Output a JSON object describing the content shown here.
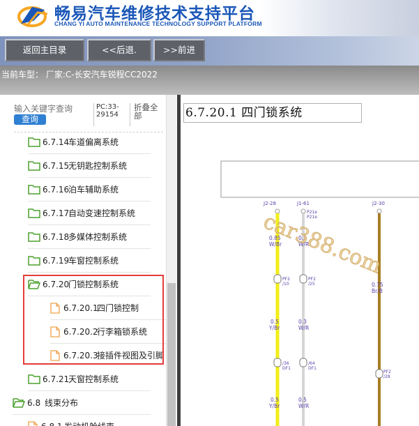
{
  "header": {
    "title_cn": "畅易汽车维修技术支持平台",
    "title_en": "CHANG YI AUTO MAINTENANCE TECHNOLOGY SUPPORT PLATFORM"
  },
  "nav": {
    "home": "返回主目录",
    "back": "<<后退.",
    "forward": ">>前进"
  },
  "model_bar": {
    "text": "当前车型： 厂家:C-长安汽车锐程CC2022"
  },
  "sidebar": {
    "search_placeholder": "输入关键字查询",
    "search_button": "查询",
    "pc_label": "PC:33-29154",
    "collapse_all": "折叠全部",
    "items": [
      {
        "code": "6.7.14",
        "label": "车道偏离系统",
        "type": "folder"
      },
      {
        "code": "6.7.15",
        "label": "无钥匙控制系统",
        "type": "folder"
      },
      {
        "code": "6.7.16",
        "label": "泊车辅助系统",
        "type": "folder"
      },
      {
        "code": "6.7.17",
        "label": "自动变速控制系统",
        "type": "folder"
      },
      {
        "code": "6.7.18",
        "label": "多媒体控制系统",
        "type": "folder"
      },
      {
        "code": "6.7.19",
        "label": "车窗控制系统",
        "type": "folder"
      },
      {
        "code": "6.7.20",
        "label": "门锁控制系统",
        "type": "folder-open"
      },
      {
        "code": "6.7.20.1",
        "label": "四门锁控制",
        "type": "file"
      },
      {
        "code": "6.7.20.2",
        "label": "行李箱锁系统",
        "type": "file"
      },
      {
        "code": "6.7.20.3",
        "label": "接插件视图及引脚",
        "type": "file"
      },
      {
        "code": "6.7.21",
        "label": "天窗控制系统",
        "type": "folder"
      },
      {
        "code": "6.8",
        "label": "线束分布",
        "type": "folder-open"
      },
      {
        "code": "6.8.1",
        "label": "发动机舱线束",
        "type": "file"
      }
    ]
  },
  "content": {
    "doc_title": "6.7.20.1 四门锁系统",
    "watermark": "car388.com",
    "connectors": [
      "J2-28",
      "J1-61",
      "J2-30"
    ],
    "pins_top": [
      "P21e",
      "P21e"
    ],
    "wires": [
      {
        "gauge": "0.85",
        "color": "W/Br"
      },
      {
        "gauge": "0.3",
        "color": "W/R"
      },
      {
        "gauge": "0.75",
        "color": "Br/B"
      },
      {
        "gauge": "0.5",
        "color": "Y/Br"
      },
      {
        "gauge": "0.3",
        "color": "W/R"
      },
      {
        "gauge": "0.5",
        "color": "Y/Br"
      },
      {
        "gauge": "0.5",
        "color": "W/R"
      }
    ],
    "junctions": [
      "PF2",
      "PF2",
      "PF2"
    ],
    "junction_sub": [
      "/10",
      "/25",
      "/28"
    ],
    "splices": [
      "/36",
      "/64"
    ],
    "splices_sub": [
      "DF1",
      "DF1"
    ]
  },
  "colors": {
    "brand_blue": "#1b57b8",
    "wire_yellow": "#f2ee1a",
    "wire_white": "#d6d6d6",
    "wire_brown": "#a77d24",
    "highlight_red": "#e53b3b"
  }
}
